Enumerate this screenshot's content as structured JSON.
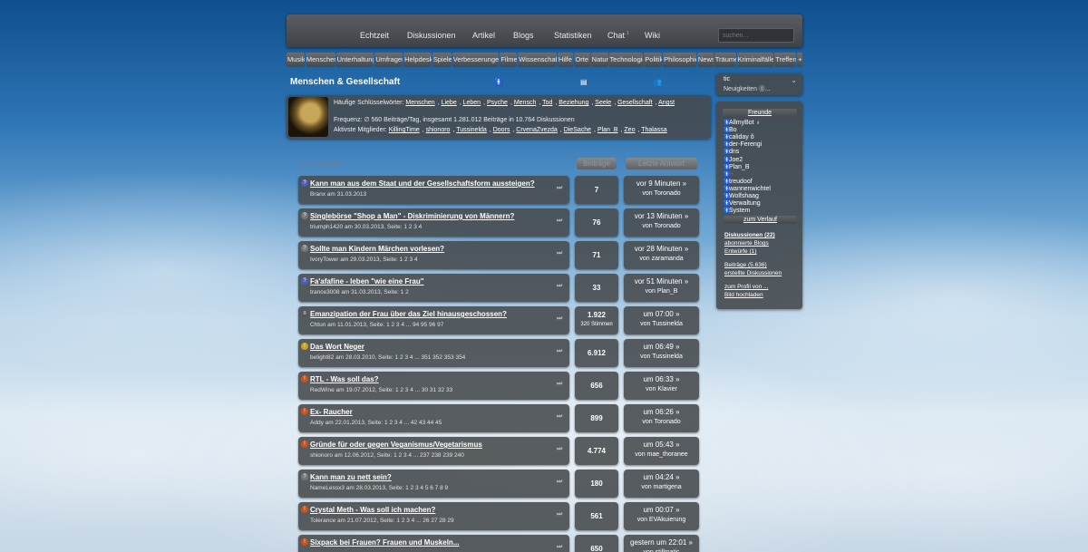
{
  "nav": {
    "items": [
      "Echtzeit",
      "Diskussionen",
      "Artikel",
      "Blogs",
      "Statistiken",
      "Chat",
      "Wiki"
    ],
    "chat_count": "1",
    "search_placeholder": "suchen..."
  },
  "categories": [
    "Musik",
    "Menschen",
    "Unterhaltung",
    "Umfragen",
    "Helpdesk",
    "Spiele",
    "Verbesserungen",
    "Filme",
    "Wissenschaft",
    "Hilfe",
    "Orte",
    "Natur",
    "Technologie",
    "Politik",
    "Philosophie",
    "News",
    "Träume",
    "Kriminalfälle",
    "Treffen",
    "+"
  ],
  "section": {
    "title": "Menschen & Gesellschaft"
  },
  "info": {
    "keywords_label": "Häufige Schlüsselwörter:",
    "keywords": [
      "Menschen",
      "Liebe",
      "Leben",
      "Psyche",
      "Mensch",
      "Tod",
      "Beziehung",
      "Seele",
      "Gesellschaft",
      "Angst"
    ],
    "frequency": "Frequenz: ∅ 560 Beiträge/Tag, insgesamt 1.281.012 Beiträge in 10.764 Diskussionen",
    "members_label": "Aktivste Mitglieder:",
    "members": [
      "KillingTime",
      "shionoro",
      "Tussinelda",
      "Doors",
      "CrvenaZvezda",
      "DieSache",
      "Plan_B",
      "Zeo",
      "Thalassa"
    ]
  },
  "table": {
    "label": "Diskussionen",
    "col_posts": "Beiträge",
    "col_last": "Letzte Antwort"
  },
  "threads": [
    {
      "title": "Kann man aus dem Staat und der Gesellschaftsform aussteigen?",
      "meta": "Branx am 31.03.2013",
      "count": "7",
      "votes": "",
      "time": "vor 9 Minuten »",
      "user": "von Toronado",
      "icon": "?",
      "icon_color": "#4a5fb8"
    },
    {
      "title": "Singlebörse \"Shop a Man\" - Diskriminierung von Männern?",
      "meta": "triumph1420 am 30.03.2013, Seite: 1 2 3 4",
      "count": "76",
      "votes": "",
      "time": "vor 13 Minuten »",
      "user": "von Toronado",
      "icon": "?",
      "icon_color": "#777777"
    },
    {
      "title": "Sollte man Kindern Märchen vorlesen?",
      "meta": "IvoryTower am 29.03.2013, Seite: 1 2 3 4",
      "count": "71",
      "votes": "",
      "time": "vor 28 Minuten »",
      "user": "von zaramanda",
      "icon": "?",
      "icon_color": "#777777"
    },
    {
      "title": "Fa'afafine - leben \"wie eine Frau\"",
      "meta": "trance3008 am 31.03.2013, Seite: 1 2",
      "count": "33",
      "votes": "",
      "time": "vor 51 Minuten »",
      "user": "von Plan_B",
      "icon": "?",
      "icon_color": "#4a5fb8"
    },
    {
      "title": "Emanzipation der Frau über das Ziel hinausgeschossen?",
      "meta": "Chtun am 11.01.2013, Seite: 1 2 3 4 ... 94 95 96 97",
      "count": "1.922",
      "votes": "320 Stimmen",
      "time": "um 07:00 »",
      "user": "von Tussinelda",
      "icon": "≡",
      "icon_color": "#555555"
    },
    {
      "title": "Das Wort Neger",
      "meta": "belight82 am 28.03.2010, Seite: 1 2 3 4 ... 351 352 353 354",
      "count": "6.912",
      "votes": "",
      "time": "um 06:49 »",
      "user": "von Tussinelda",
      "icon": "!",
      "icon_color": "#c9a21a"
    },
    {
      "title": "RTL - Was soll das?",
      "meta": "RedWine am 19.07.2012, Seite: 1 2 3 4 ... 30 31 32 33",
      "count": "656",
      "votes": "",
      "time": "um 06:33 »",
      "user": "von Klavier",
      "icon": "!",
      "icon_color": "#c9521a"
    },
    {
      "title": "Ex- Raucher",
      "meta": "Addy am 22.01.2013, Seite: 1 2 3 4 ... 42 43 44 45",
      "count": "899",
      "votes": "",
      "time": "um 06:26 »",
      "user": "von Toronado",
      "icon": "!",
      "icon_color": "#c9521a"
    },
    {
      "title": "Gründe für oder gegen Veganismus/Vegetarismus",
      "meta": "shionoro am 12.06.2012, Seite: 1 2 3 4 ... 237 238 239 240",
      "count": "4.774",
      "votes": "",
      "time": "um 05:43 »",
      "user": "von mae_thoranee",
      "icon": "!",
      "icon_color": "#c9521a"
    },
    {
      "title": "Kann man zu nett sein?",
      "meta": "NameLessx3 am 28.03.2013, Seite: 1 2 3 4 5 6 7 8 9",
      "count": "180",
      "votes": "",
      "time": "um 04:24 »",
      "user": "von martigena",
      "icon": "?",
      "icon_color": "#777777"
    },
    {
      "title": "Crystal Meth - Was soll ich machen?",
      "meta": "Tolerance am 21.07.2012, Seite: 1 2 3 4 ... 26 27 28 29",
      "count": "561",
      "votes": "",
      "time": "um 00:07 »",
      "user": "von EVAkuierung",
      "icon": "!",
      "icon_color": "#c9521a"
    },
    {
      "title": "Sixpack bei Frauen? Frauen und Muskeln...",
      "meta": "",
      "count": "650",
      "votes": "",
      "time": "gestern um 22:01 »",
      "user": "von stillmatic",
      "icon": "!",
      "icon_color": "#c9521a"
    }
  ],
  "userbar": {
    "line1": "tic",
    "line2": "Neuigkeiten ⓪..."
  },
  "sidebar": {
    "friends_label": "Freunde",
    "friends": [
      {
        "name": "AllmyBot",
        "extra": "♁",
        "color": "#ffffff"
      },
      {
        "name": "Bo",
        "extra": "",
        "color": "#ffffff"
      },
      {
        "name": "caliday",
        "extra": "ǒ",
        "color": "#ffffff"
      },
      {
        "name": "der-Ferengi",
        "extra": "",
        "color": "#ffffff"
      },
      {
        "name": "dns",
        "extra": "",
        "color": "#ffffff"
      },
      {
        "name": "Joe2",
        "extra": "",
        "color": "#ffffff"
      },
      {
        "name": "Plan_B",
        "extra": "",
        "color": "#ffffff"
      },
      {
        "name": "••",
        "extra": "",
        "color": "#e03030"
      },
      {
        "name": "treudoof",
        "extra": "",
        "color": "#ffffff"
      },
      {
        "name": "wannenwichtel",
        "extra": "",
        "color": "#ffffff"
      },
      {
        "name": "Wolfshaag",
        "extra": "",
        "color": "#ffffff"
      },
      {
        "name": "Verwaltung",
        "extra": "",
        "color": "#ffffff"
      },
      {
        "name": "System",
        "extra": "",
        "color": "#ffffff"
      }
    ],
    "verlauf": "zum Verlauf",
    "links": [
      {
        "text": "Diskussionen (22)",
        "bold": true
      },
      {
        "text": "abonnierte Blogs",
        "bold": false
      },
      {
        "text": "Entwürfe (1)",
        "bold": false
      },
      {
        "text": "Beiträge (5.636)",
        "bold": false
      },
      {
        "text": "erstellte Diskussionen",
        "bold": false
      },
      {
        "text": "zum Profil von ...",
        "bold": false
      },
      {
        "text": "Bild hochladen",
        "bold": false
      }
    ]
  }
}
